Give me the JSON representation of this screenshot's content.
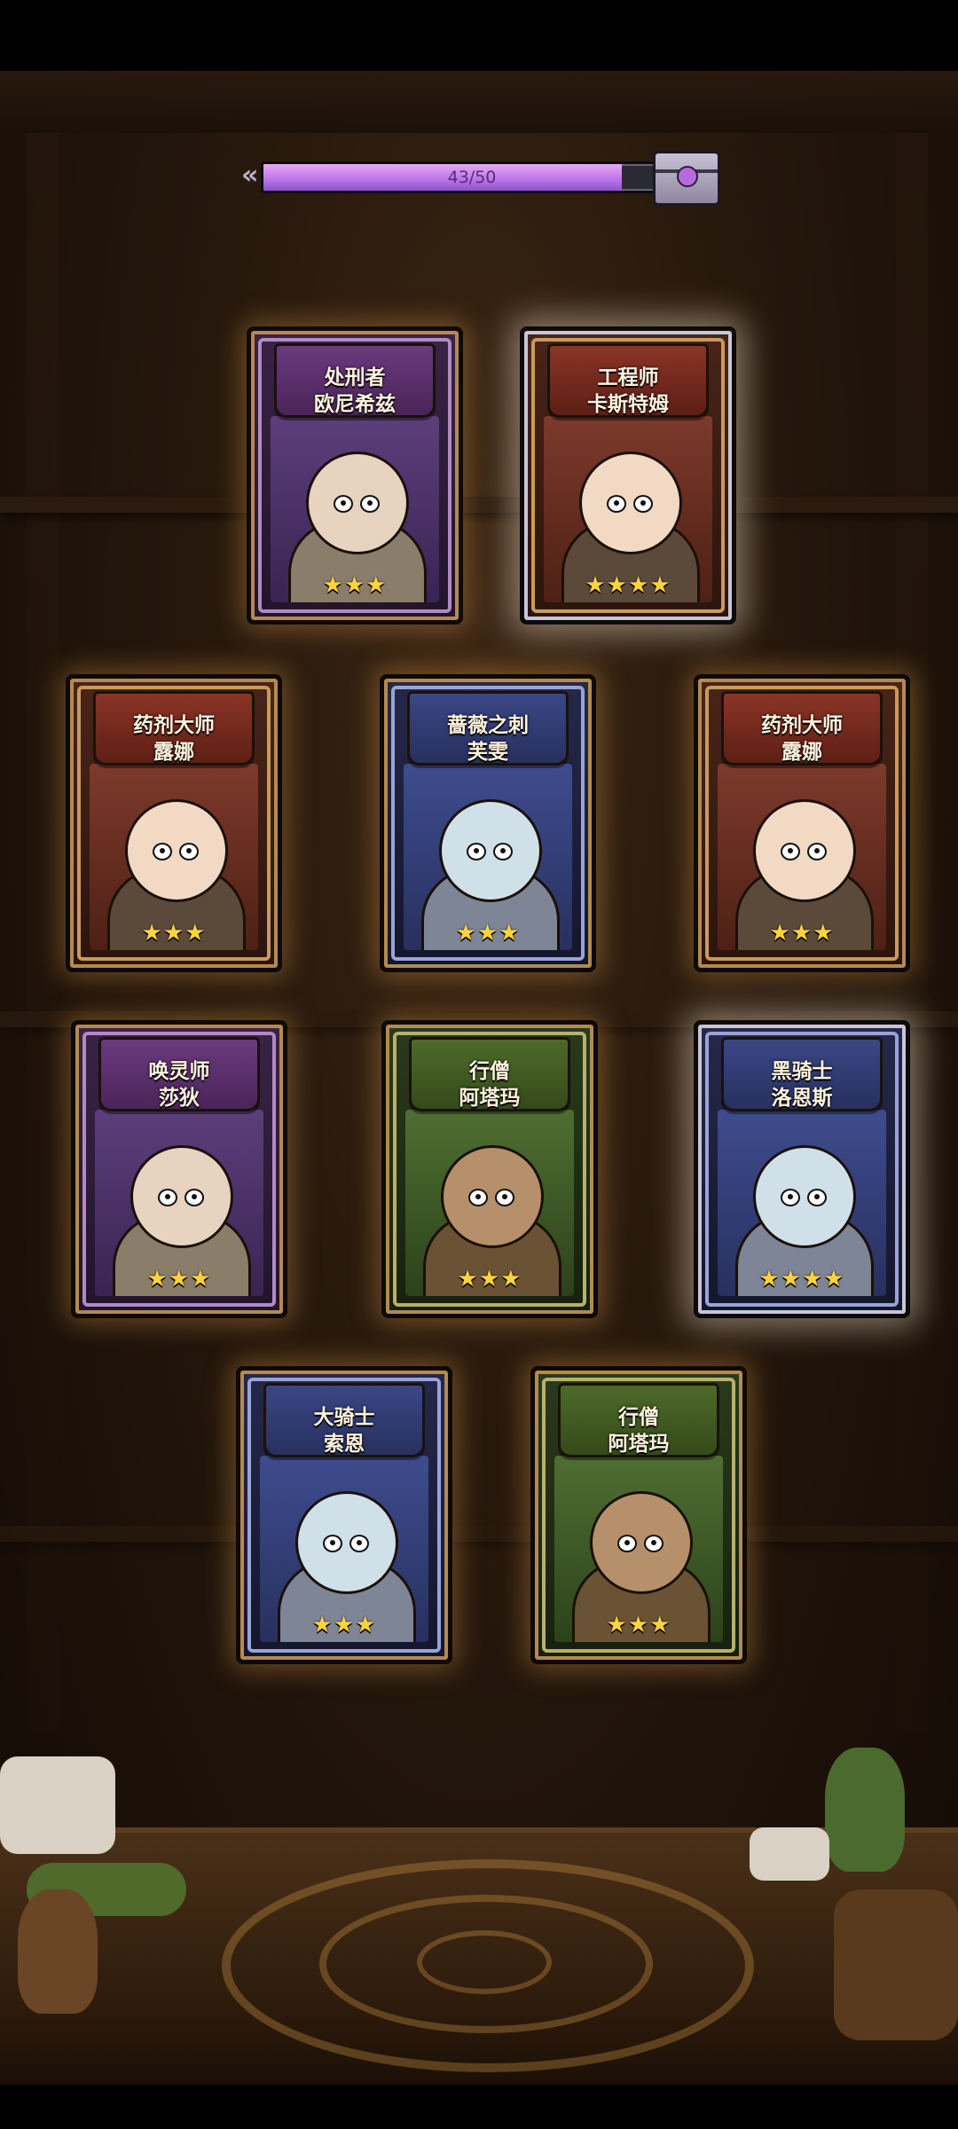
{
  "progress": {
    "current": 43,
    "max": 50,
    "fraction": 0.86,
    "text": "43/50",
    "back_icon": "double-chevron-left-icon",
    "reward_icon": "treasure-chest-icon"
  },
  "colors": {
    "progress_fill": "#c27ee8",
    "star": "#ffd43a",
    "card_glow": "#f0aa50"
  },
  "cards": [
    {
      "line1": "处刑者",
      "line2": "欧尼希兹",
      "stars": "★★★",
      "star_count": 3,
      "theme": "purple",
      "portrait": "executioner-portrait"
    },
    {
      "line1": "工程师",
      "line2": "卡斯特姆",
      "stars": "★★★★",
      "star_count": 4,
      "theme": "red",
      "portrait": "engineer-portrait"
    },
    {
      "line1": "药剂大师",
      "line2": "露娜",
      "stars": "★★★",
      "star_count": 3,
      "theme": "red",
      "portrait": "alchemist-portrait"
    },
    {
      "line1": "蔷薇之刺",
      "line2": "芙雯",
      "stars": "★★★",
      "star_count": 3,
      "theme": "blue",
      "portrait": "rose-thorn-portrait"
    },
    {
      "line1": "药剂大师",
      "line2": "露娜",
      "stars": "★★★",
      "star_count": 3,
      "theme": "red",
      "portrait": "alchemist-portrait"
    },
    {
      "line1": "唤灵师",
      "line2": "莎狄",
      "stars": "★★★",
      "star_count": 3,
      "theme": "purple",
      "portrait": "necromancer-portrait"
    },
    {
      "line1": "行僧",
      "line2": "阿塔玛",
      "stars": "★★★",
      "star_count": 3,
      "theme": "green",
      "portrait": "monk-portrait"
    },
    {
      "line1": "黑骑士",
      "line2": "洛恩斯",
      "stars": "★★★★",
      "star_count": 4,
      "theme": "blue",
      "portrait": "black-knight-portrait"
    },
    {
      "line1": "大骑士",
      "line2": "索恩",
      "stars": "★★★",
      "star_count": 3,
      "theme": "blue",
      "portrait": "grand-knight-portrait"
    },
    {
      "line1": "行僧",
      "line2": "阿塔玛",
      "stars": "★★★",
      "star_count": 3,
      "theme": "green",
      "portrait": "monk-portrait"
    }
  ]
}
